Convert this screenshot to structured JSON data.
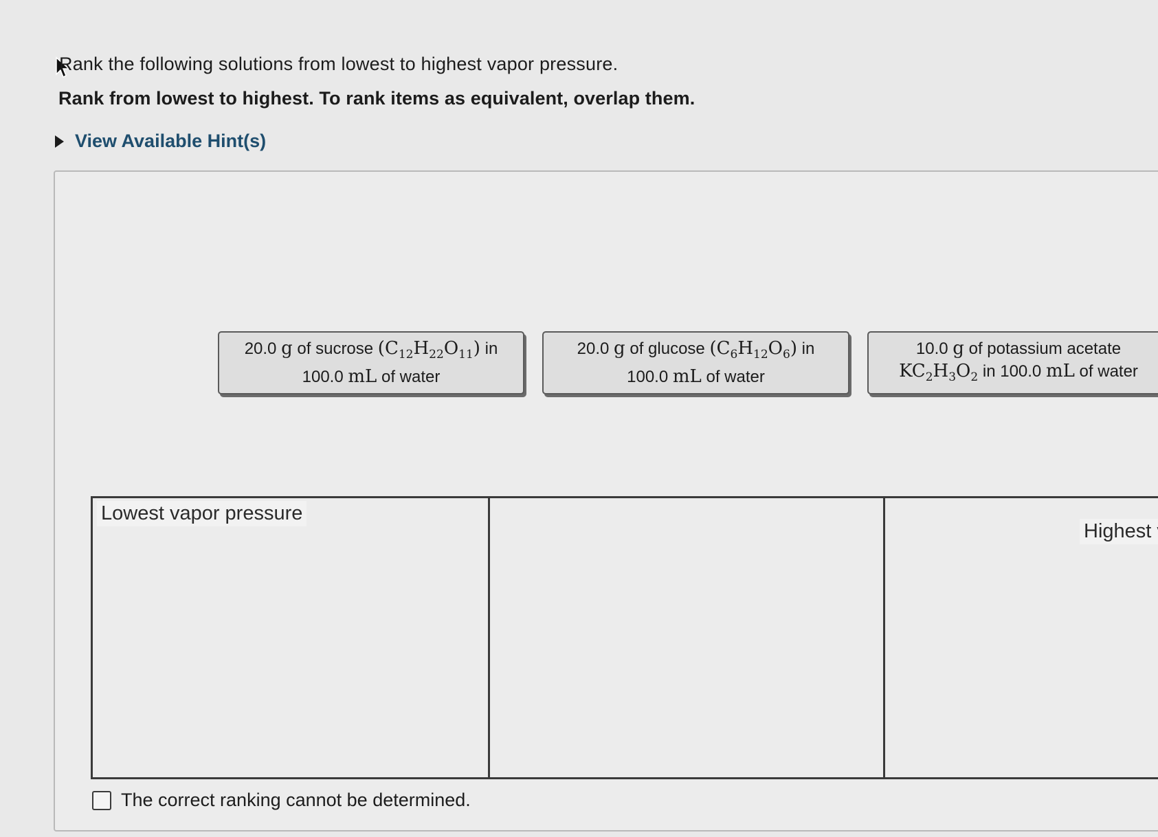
{
  "question": "Rank the following solutions from lowest to highest vapor pressure.",
  "instruction": "Rank from lowest to highest. To rank items as equivalent, overlap them.",
  "hint_label": "View Available Hint(s)",
  "cards": [
    {
      "line1_prefix": "20.0",
      "line1_unit": "g",
      "line1_text": "of sucrose",
      "formula": [
        "(C",
        "12",
        "H",
        "22",
        "O",
        "11",
        ")"
      ],
      "line1_suffix": "in",
      "line2_amount": "100.0",
      "line2_unit": "mL",
      "line2_text": "of water"
    },
    {
      "line1_prefix": "20.0",
      "line1_unit": "g",
      "line1_text": "of glucose",
      "formula": [
        "(C",
        "6",
        "H",
        "12",
        "O",
        "6",
        ")"
      ],
      "line1_suffix": "in",
      "line2_amount": "100.0",
      "line2_unit": "mL",
      "line2_text": "of water"
    },
    {
      "line1_prefix": "10.0",
      "line1_unit": "g",
      "line1_text": "of potassium acetate",
      "formula": [
        "KC",
        "2",
        "H",
        "3",
        "O",
        "2",
        ""
      ],
      "line2_amount": "in 100.0",
      "line2_unit": "mL",
      "line2_text": "of water"
    }
  ],
  "ranking": {
    "lowest_label": "Lowest vapor pressure",
    "highest_label": "Highest v"
  },
  "checkbox_label": "The correct ranking cannot be determined.",
  "checkbox_checked": false
}
